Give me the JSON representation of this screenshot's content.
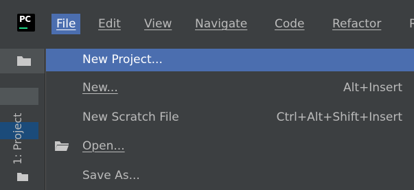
{
  "logo": {
    "text": "PC"
  },
  "menubar": {
    "items": [
      {
        "label": "File",
        "active": true
      },
      {
        "label": "Edit"
      },
      {
        "label": "View"
      },
      {
        "label": "Navigate"
      },
      {
        "label": "Code"
      },
      {
        "label": "Refactor"
      },
      {
        "label": "R"
      }
    ]
  },
  "toolwindow": {
    "project_label": "1: Project"
  },
  "file_menu": {
    "items": [
      {
        "label": "New Project...",
        "shortcut": ""
      },
      {
        "label": "New...",
        "shortcut": "Alt+Insert"
      },
      {
        "label": "New Scratch File",
        "shortcut": "Ctrl+Alt+Shift+Insert"
      },
      {
        "label": "Open...",
        "shortcut": "",
        "icon": "folder-open-icon"
      },
      {
        "label": "Save As...",
        "shortcut": ""
      }
    ]
  },
  "colors": {
    "background": "#3c3f41",
    "selection": "#4b6eaf",
    "text": "#bbbbbb"
  }
}
